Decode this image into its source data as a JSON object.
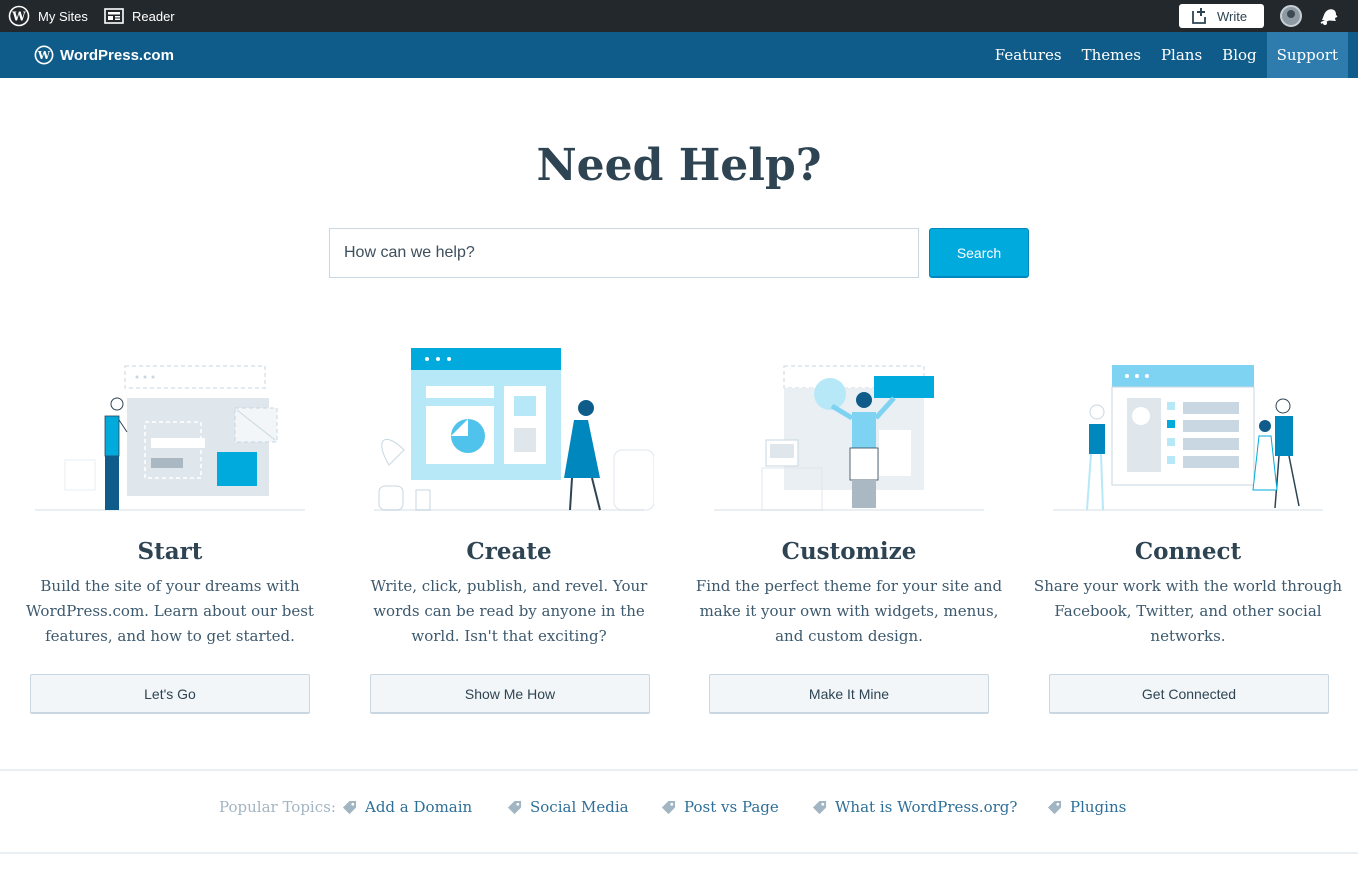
{
  "adminbar": {
    "my_sites": "My Sites",
    "reader": "Reader",
    "write": "Write"
  },
  "masterbar": {
    "brand": "WordPress.com",
    "nav": [
      "Features",
      "Themes",
      "Plans",
      "Blog",
      "Support"
    ],
    "active": "Support"
  },
  "hero": {
    "title": "Need Help?",
    "search_placeholder": "How can we help?",
    "search_button": "Search"
  },
  "cards": [
    {
      "title": "Start",
      "description": "Build the site of your dreams with WordPress.com. Learn about our best features, and how to get started.",
      "button": "Let's Go"
    },
    {
      "title": "Create",
      "description": "Write, click, publish, and revel. Your words can be read by anyone in the world. Isn't that exciting?",
      "button": "Show Me How"
    },
    {
      "title": "Customize",
      "description": "Find the perfect theme for your site and make it your own with widgets, menus, and custom design.",
      "button": "Make It Mine"
    },
    {
      "title": "Connect",
      "description": "Share your work with the world through Facebook, Twitter, and other social networks.",
      "button": "Get Connected"
    }
  ],
  "topics": {
    "label": "Popular Topics:",
    "items": [
      "Add a Domain",
      "Social Media",
      "Post vs Page",
      "What is WordPress.org?",
      "Plugins"
    ]
  },
  "colors": {
    "admin_bar": "#23282d",
    "masterbar": "#0f5c8a",
    "accent": "#00aadc",
    "heading": "#2e4453"
  }
}
